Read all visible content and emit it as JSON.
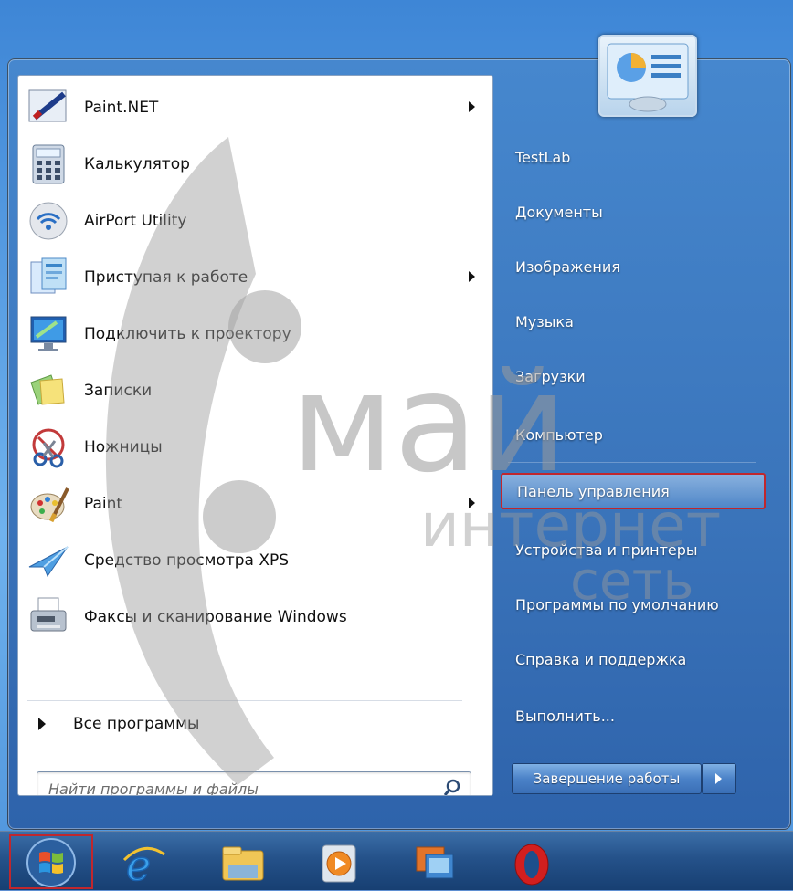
{
  "start_menu": {
    "programs": [
      {
        "label": "Paint.NET",
        "icon": "paintnet-icon",
        "has_submenu": true
      },
      {
        "label": "Калькулятор",
        "icon": "calculator-icon",
        "has_submenu": false
      },
      {
        "label": "AirPort Utility",
        "icon": "airport-icon",
        "has_submenu": false
      },
      {
        "label": "Приступая к работе",
        "icon": "getting-started-icon",
        "has_submenu": true
      },
      {
        "label": "Подключить к проектору",
        "icon": "projector-icon",
        "has_submenu": false
      },
      {
        "label": "Записки",
        "icon": "sticky-notes-icon",
        "has_submenu": false
      },
      {
        "label": "Ножницы",
        "icon": "scissors-icon",
        "has_submenu": false
      },
      {
        "label": "Paint",
        "icon": "paint-icon",
        "has_submenu": true
      },
      {
        "label": "Средство просмотра XPS",
        "icon": "xps-viewer-icon",
        "has_submenu": false
      },
      {
        "label": "Факсы и сканирование Windows",
        "icon": "fax-scan-icon",
        "has_submenu": false
      }
    ],
    "all_programs_label": "Все программы",
    "search": {
      "placeholder": "Найти программы и файлы"
    },
    "places": [
      {
        "label": "TestLab"
      },
      {
        "label": "Документы"
      },
      {
        "label": "Изображения"
      },
      {
        "label": "Музыка"
      },
      {
        "label": "Загрузки"
      },
      {
        "label": "Компьютер"
      },
      {
        "label": "Панель управления",
        "highlighted": true
      },
      {
        "label": "Устройства и принтеры"
      },
      {
        "label": "Программы по умолчанию"
      },
      {
        "label": "Справка и поддержка"
      },
      {
        "label": "Выполнить..."
      }
    ],
    "shutdown_label": "Завершение работы"
  },
  "watermark": {
    "line1": "май",
    "line2": "интернет",
    "line3": "сеть"
  },
  "taskbar": {
    "icons": [
      "windows-start-icon",
      "internet-explorer-icon",
      "file-explorer-icon",
      "media-player-icon",
      "remote-desktop-icon",
      "opera-icon"
    ]
  },
  "colors": {
    "highlight_border": "#c0272d",
    "taskbar": "#25528a"
  }
}
